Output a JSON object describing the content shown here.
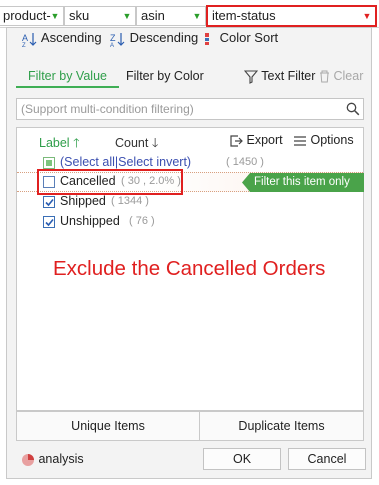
{
  "header": {
    "columns": [
      {
        "label": "product-"
      },
      {
        "label": "sku"
      },
      {
        "label": "asin"
      },
      {
        "label": "item-status"
      }
    ]
  },
  "sort": {
    "ascending_label": "Ascending",
    "descending_label": "Descending",
    "color_sort_label": "Color Sort"
  },
  "filter_tabs": {
    "by_value": "Filter by Value",
    "by_color": "Filter by Color",
    "text_filter": "Text Filter",
    "clear": "Clear"
  },
  "search": {
    "placeholder": "(Support multi-condition filtering)"
  },
  "list_header": {
    "label_col": "Label",
    "count_col": "Count",
    "export": "Export",
    "options": "Options"
  },
  "items": [
    {
      "label": "(Select all|Select invert)",
      "count": "( 1450 )"
    },
    {
      "label": "Cancelled",
      "count": "( 30 , 2.0% )"
    },
    {
      "label": "Shipped",
      "count": "( 1344 )"
    },
    {
      "label": "Unshipped",
      "count": "( 76 )"
    }
  ],
  "filter_only_tip": "Filter this item only",
  "annotation": "Exclude the Cancelled Orders",
  "bottom_buttons": {
    "unique": "Unique Items",
    "duplicate": "Duplicate Items"
  },
  "footer": {
    "analysis": "analysis",
    "ok": "OK",
    "cancel": "Cancel"
  },
  "colors": {
    "accent_green": "#3fae55",
    "highlight_red": "#e02020",
    "checkbox_blue": "#3b6fb6"
  }
}
